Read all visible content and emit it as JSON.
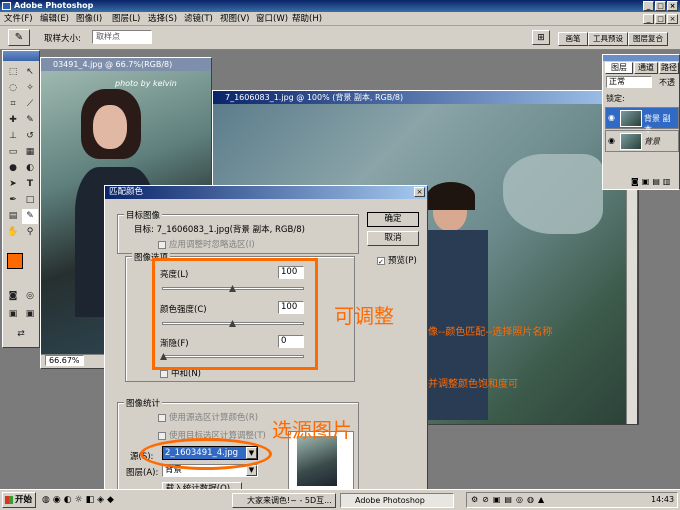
{
  "app": {
    "title": "Adobe Photoshop"
  },
  "menu": [
    "文件(F)",
    "编辑(E)",
    "图像(I)",
    "图层(L)",
    "选择(S)",
    "滤镜(T)",
    "视图(V)",
    "窗口(W)",
    "帮助(H)"
  ],
  "options": {
    "sample_label": "取样大小:",
    "sample_value": "取样点",
    "palette_tabs": [
      "画笔",
      "工具预设",
      "图层复合"
    ]
  },
  "doc1": {
    "title": "03491_4.jpg @ 66.7%(RGB/8)",
    "zoom": "66.67%",
    "watermark": "photo by kelvin"
  },
  "doc2": {
    "title": "7_1606083_1.jpg @ 100% (背景 副本, RGB/8)"
  },
  "layers": {
    "tabs": [
      "图层",
      "通道",
      "路径"
    ],
    "blend": "正常",
    "opacity_label": "不透",
    "lock_label": "锁定:",
    "items": [
      "背景 副本",
      "背景"
    ]
  },
  "dialog": {
    "title": "匹配颜色",
    "target_group": "目标图像",
    "target_text": "目标:  7_1606083_1.jpg(背景 副本, RGB/8)",
    "apply_selection": "应用调整时忽略选区(I)",
    "options_group": "图像选项",
    "luminance_label": "亮度(L)",
    "luminance": "100",
    "intensity_label": "颜色强度(C)",
    "intensity": "100",
    "fade_label": "渐隐(F)",
    "fade": "0",
    "neutralize": "中和(N)",
    "stats_group": "图像统计",
    "use_source_sel": "使用源选区计算颜色(R)",
    "use_target_sel": "使用目标选区计算调整(T)",
    "source_label": "源(S):",
    "source_value": "2_1603491_4.jpg",
    "layer_label": "图层(A):",
    "layer_value": "背景",
    "load_stats": "载入统计数据(O)...",
    "ok": "确定",
    "cancel": "取消",
    "preview": "预览(P)"
  },
  "annotations": {
    "adjustable": "可调整",
    "select_source": "选源图片",
    "note1": "像--颜色匹配--选择照片名称",
    "note2": "并调整颜色饱和度可"
  },
  "taskbar": {
    "start": "开始",
    "tasks": [
      "大家来调色!~ - 5D互...",
      "Adobe Photoshop"
    ],
    "clock": "14:43"
  },
  "colors": {
    "foreground": "#ff6a00",
    "annotation": "#ff6a00",
    "titlebar": "#0a246a"
  }
}
